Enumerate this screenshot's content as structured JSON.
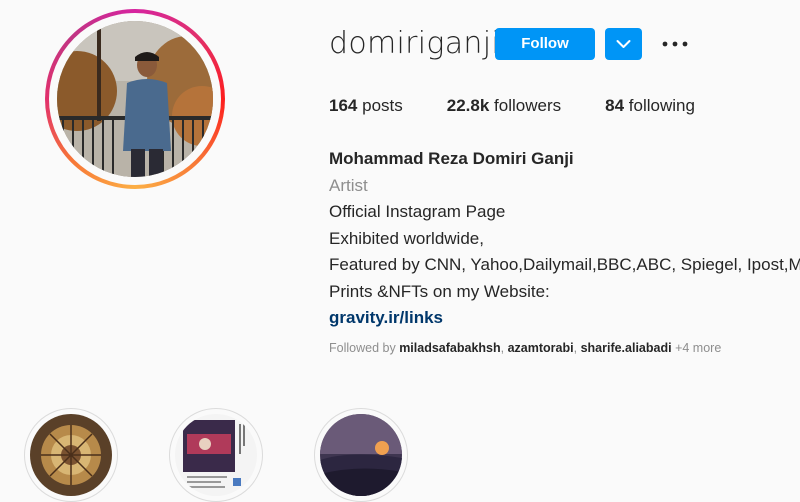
{
  "profile": {
    "username": "domiriganji",
    "follow_label": "Follow",
    "stats": {
      "posts_count": "164",
      "posts_label": "posts",
      "followers_count": "22.8k",
      "followers_label": "followers",
      "following_count": "84",
      "following_label": "following"
    },
    "bio": {
      "full_name": "Mohammad Reza Domiri Ganji",
      "category": "Artist",
      "lines": [
        "Official Instagram Page",
        "Exhibited worldwide,",
        "Featured by CNN, Yahoo,Dailymail,BBC,ABC, Spiegel, Ipost,MSN..",
        "Prints &NFTs on my Website:"
      ],
      "link": "gravity.ir/links"
    },
    "followed_by": {
      "prefix": "Followed by",
      "users": [
        "miladsafabakhsh",
        "azamtorabi",
        "sharife.aliabadi"
      ],
      "separator": ",",
      "more": "+4 more"
    }
  },
  "highlights": [
    {
      "name": "highlight-dome"
    },
    {
      "name": "highlight-magazine"
    },
    {
      "name": "highlight-sunset"
    }
  ],
  "colors": {
    "accent": "#0095f6",
    "link": "#00376b",
    "muted": "#8e8e8e",
    "text": "#262626",
    "background": "#fafafa"
  },
  "icons": {
    "dropdown": "chevron-down-icon",
    "more": "more-options-icon"
  }
}
